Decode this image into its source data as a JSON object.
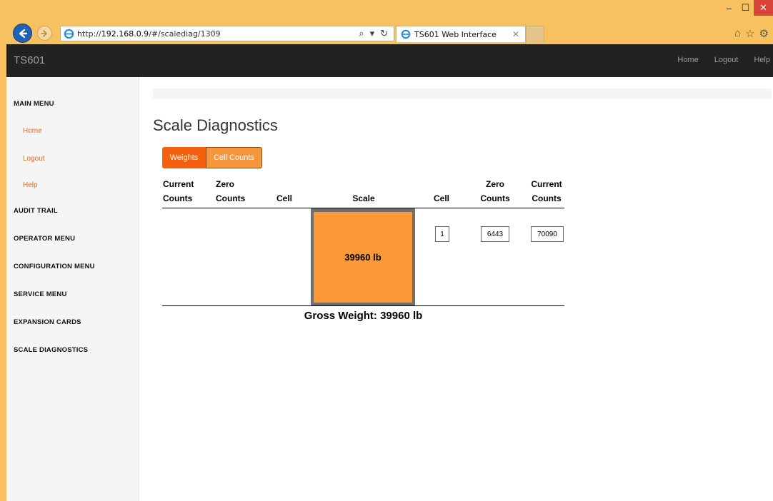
{
  "browser": {
    "url_prefix": "http://",
    "url_host": "192.168.0.9",
    "url_path": "/#/scalediag/1309",
    "tab_title": "TS601 Web Interface",
    "icons": [
      "back-arrow-icon",
      "forward-arrow-icon",
      "ie-logo-icon",
      "search-icon",
      "refresh-icon",
      "close-icon",
      "home-icon",
      "star-icon",
      "gear-icon"
    ]
  },
  "navbar": {
    "brand": "TS601",
    "links": [
      "Home",
      "Logout",
      "Help"
    ]
  },
  "sidebar": {
    "main_menu": "MAIN MENU",
    "main_links": [
      "Home",
      "Logout",
      "Help"
    ],
    "sections": [
      "AUDIT TRAIL",
      "OPERATOR MENU",
      "CONFIGURATION MENU",
      "SERVICE MENU",
      "EXPANSION CARDS",
      "SCALE DIAGNOSTICS"
    ]
  },
  "page": {
    "title": "Scale Diagnostics",
    "buttons": {
      "weights": "Weights",
      "cell_counts": "Cell Counts"
    }
  },
  "diagnostics": {
    "headers": {
      "current_counts_left": [
        "Current",
        "Counts"
      ],
      "zero_counts_left": [
        "Zero",
        "Counts"
      ],
      "cell_left": "Cell",
      "scale": "Scale",
      "cell_right": "Cell",
      "zero_counts_right": [
        "Zero",
        "Counts"
      ],
      "current_counts_right": [
        "Current",
        "Counts"
      ]
    },
    "scale_weight": "39960 lb",
    "right_cell": {
      "cell": "1",
      "zero_counts": "6443",
      "current_counts": "70090"
    },
    "gross_weight": "Gross Weight: 39960 lb"
  },
  "colors": {
    "accent": "#f0661a",
    "scale_fill": "#fb9936",
    "navbar_bg": "#222222",
    "sidebar_bg": "#f5f5f5"
  }
}
